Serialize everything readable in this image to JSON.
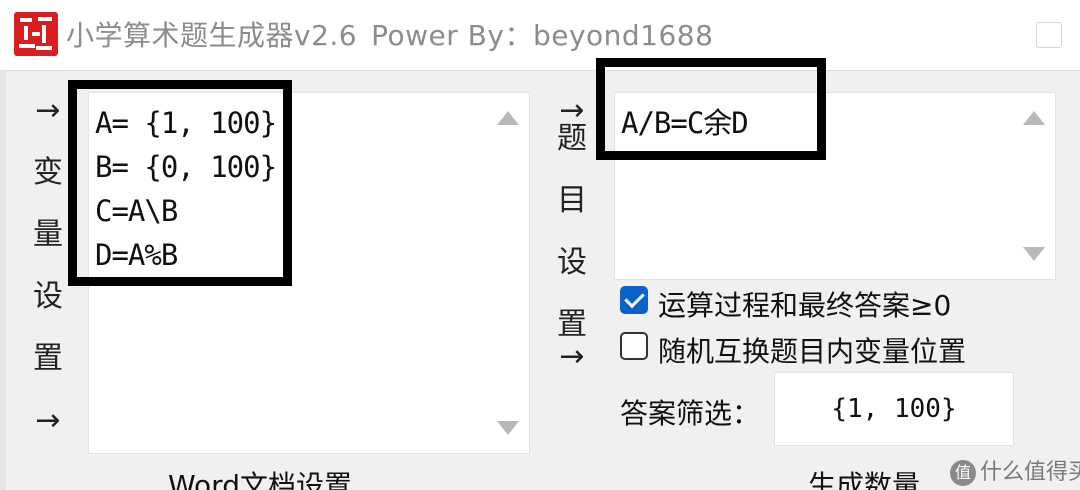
{
  "window": {
    "title": "小学算术题生成器v2.6",
    "subtitle": "Power By：beyond1688"
  },
  "variables_panel": {
    "arrow_top": "→",
    "label_chars": [
      "变",
      "量",
      "设",
      "置"
    ],
    "arrow_bottom": "→",
    "text": "A= {1, 100}\nB= {0, 100}\nC=A\\B\nD=A%B"
  },
  "question_panel": {
    "arrow_top": "→",
    "label_chars": [
      "题",
      "目",
      "设",
      "置"
    ],
    "arrow_bottom": "→",
    "text": "A/B=C余D"
  },
  "options": {
    "nonneg_label": "运算过程和最终答案≥0",
    "nonneg_checked": true,
    "swap_label": "随机互换题目内变量位置",
    "swap_checked": false
  },
  "filter": {
    "label": "答案筛选：",
    "value": "{1, 100}"
  },
  "bottom": {
    "left_label": "Word文档设置",
    "right_label": "生成数量"
  },
  "watermark": {
    "logo": "值",
    "text": "什么值得买"
  },
  "colors": {
    "accent_checkbox": "#0a63c9",
    "app_icon_red": "#d81e1e",
    "highlight_border": "#000000"
  }
}
